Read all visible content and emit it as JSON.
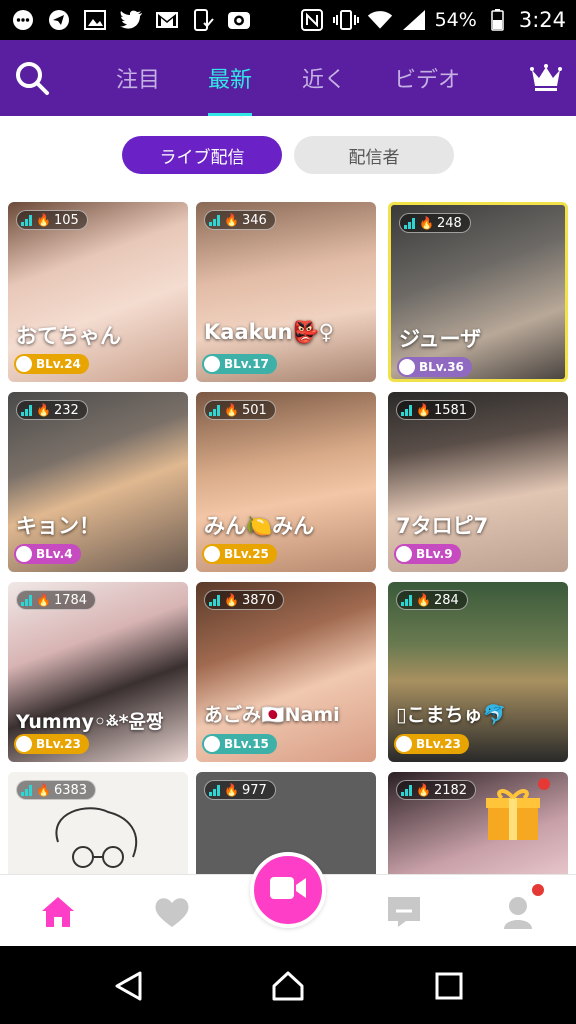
{
  "status_bar": {
    "battery": "54%",
    "time": "3:24",
    "left_icons": [
      "messenger-icon",
      "telegram-icon",
      "gallery-icon",
      "twitter-icon",
      "gmail-icon",
      "phone-check-icon",
      "camera-app-icon"
    ],
    "right_icons": [
      "nfc-icon",
      "vibrate-icon",
      "wifi-icon",
      "signal-icon",
      "battery-icon"
    ]
  },
  "header": {
    "tabs": [
      {
        "label": "注目"
      },
      {
        "label": "最新"
      },
      {
        "label": "近く"
      },
      {
        "label": "ビデオ"
      }
    ],
    "active_tab": "最新",
    "colors": {
      "bar": "#5a1fa0",
      "active": "#32e6e6"
    }
  },
  "segment": {
    "live_label": "ライブ配信",
    "hosts_label": "配信者",
    "selected": "ライブ配信"
  },
  "streams": [
    {
      "viewers": "105",
      "name": "おてちゃん",
      "level": "BLv.24"
    },
    {
      "viewers": "346",
      "name": "Kaakun👺♀",
      "level": "BLv.17"
    },
    {
      "viewers": "248",
      "name": "ジューザ",
      "level": "BLv.36"
    },
    {
      "viewers": "232",
      "name": "キョン！",
      "level": "BLv.4"
    },
    {
      "viewers": "501",
      "name": "みん🍋みん",
      "level": "BLv.25"
    },
    {
      "viewers": "1581",
      "name": "7タロピ7",
      "level": "BLv.9"
    },
    {
      "viewers": "1784",
      "name": "Yummy◦࿏*윤짱",
      "level": "BLv.23"
    },
    {
      "viewers": "3870",
      "name": "あごみ🇯🇵Nami",
      "level": "BLv.15"
    },
    {
      "viewers": "284",
      "name": "▯こまちゅ🐬",
      "level": "BLv.23"
    },
    {
      "viewers": "6383",
      "name": "",
      "level": ""
    },
    {
      "viewers": "977",
      "name": "",
      "level": ""
    },
    {
      "viewers": "2182",
      "name": "",
      "level": ""
    }
  ],
  "bottom_nav": {
    "items": [
      "home-icon",
      "heart-icon",
      "video-camera-icon",
      "chat-icon",
      "profile-icon"
    ],
    "accent": "#ff3ec8"
  },
  "system_nav": {
    "items": [
      "back-icon",
      "home-icon",
      "recents-icon"
    ]
  }
}
